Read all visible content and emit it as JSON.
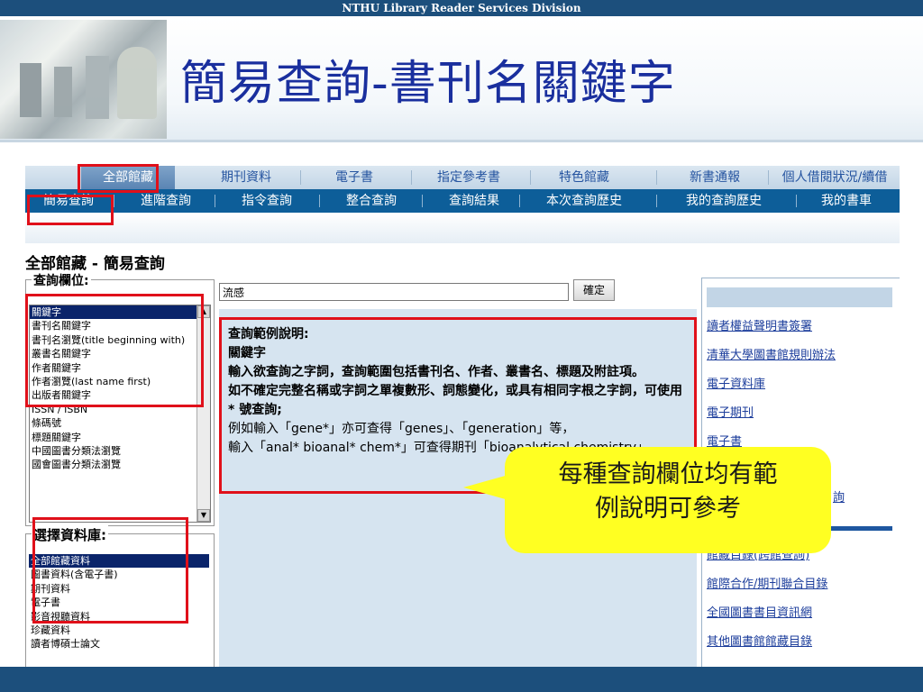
{
  "slide": {
    "header_text": "NTHU Library Reader Services Division",
    "title": "簡易查詢-書刊名關鍵字"
  },
  "tabs": [
    "全部館藏",
    "期刊資料",
    "電子書",
    "指定參考書",
    "特色館藏",
    "新書通報",
    "個人借閱狀況/續借"
  ],
  "subnav": [
    "簡易查詢",
    "進階查詢",
    "指令查詢",
    "整合查詢",
    "查詢結果",
    "本次查詢歷史",
    "我的查詢歷史",
    "我的書車"
  ],
  "page_heading": "全部館藏 - 簡易查詢",
  "field_legend": "查詢欄位:",
  "field_options": [
    "關鍵字",
    "書刊名關鍵字",
    "書刊名瀏覽(title beginning with)",
    "叢書名關鍵字",
    "作者關鍵字",
    "作者瀏覽(last name first)",
    "出版者關鍵字",
    "ISSN / ISBN",
    "條碼號",
    "標題關鍵字",
    "中國圖書分類法瀏覽",
    "國會圖書分類法瀏覽"
  ],
  "db_legend": "選擇資料庫:",
  "db_options": [
    "全部館藏資料",
    "圖書資料(含電子書)",
    "期刊資料",
    "電子書",
    "影音視聽資料",
    "珍藏資料",
    "讀者博碩士論文"
  ],
  "search": {
    "value": "流感",
    "submit_label": "確定"
  },
  "help": {
    "heading": "查詢範例說明:",
    "subheading": "關鍵字",
    "para1": "輸入欲查詢之字詞，查詢範圍包括書刊名、作者、叢書名、標題及附註項。",
    "para2": "如不確定完整名稱或字詞之單複數形、詞態變化，或具有相同字根之字詞，可使用 * 號查詢;",
    "para3": "例如輸入「gene*」亦可查得「genes」、「generation」等，",
    "para4": "輸入「anal* bioanal* chem*」可查得期刊「bioanalytical chemistry」。"
  },
  "right_links": [
    "讀者權益聲明書簽署",
    "清華大學圖書館規則辦法",
    "電子資料庫",
    "電子期刊",
    "電子書",
    "",
    "館藏目錄(跨館查詢)",
    "館際合作/期刊聯合目錄",
    "全國圖書書目資訊網",
    "其他圖書館館藏目錄"
  ],
  "right_partial_text": "詢",
  "callout": {
    "line1": "每種查詢欄位均有範",
    "line2": "例說明可參考"
  },
  "colors": {
    "accent": "#0d5e99",
    "annotation_red": "#e0101a",
    "callout_yellow": "#ffff22",
    "title_blue": "#1a2f9e"
  }
}
